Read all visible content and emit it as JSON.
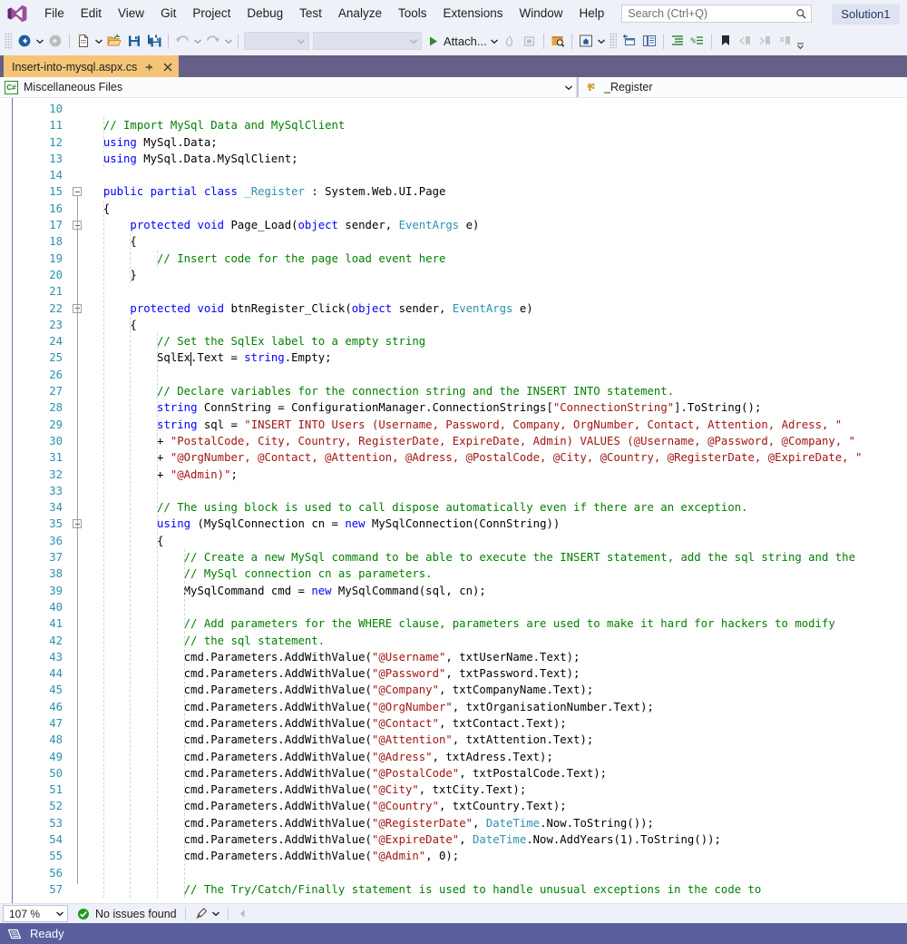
{
  "app": {
    "solution_chip": "Solution1"
  },
  "menubar": {
    "logo_icon": "visual-studio-logo",
    "items": [
      {
        "label": "File"
      },
      {
        "label": "Edit"
      },
      {
        "label": "View"
      },
      {
        "label": "Git"
      },
      {
        "label": "Project"
      },
      {
        "label": "Debug"
      },
      {
        "label": "Test"
      },
      {
        "label": "Analyze"
      },
      {
        "label": "Tools"
      },
      {
        "label": "Extensions"
      },
      {
        "label": "Window"
      },
      {
        "label": "Help"
      }
    ],
    "search": {
      "placeholder": "Search (Ctrl+Q)",
      "value": "",
      "icon": "search-icon"
    }
  },
  "toolbar": {
    "back_icon": "navigate-backward-icon",
    "forward_icon": "navigate-forward-icon",
    "new_item_icon": "new-item-icon",
    "open_file_icon": "open-file-icon",
    "save_icon": "save-icon",
    "save_all_icon": "save-all-icon",
    "undo_icon": "undo-icon",
    "redo_icon": "redo-icon",
    "combo1_value": "",
    "combo2_value": "",
    "attach_label": "Attach...",
    "attach_play_icon": "start-debug-icon",
    "hot_reload_icon": "hot-reload-icon",
    "stop_icon": "stop-icon",
    "find_in_files_icon": "find-in-files-icon",
    "solution_explorer_icon": "home-icon",
    "properties_window_icon": "properties-window-icon",
    "toolbox_icon": "toolbox-icon",
    "indent_icon": "indent-icon",
    "comment_icon": "comment-icon",
    "bookmark_icon": "bookmark-icon",
    "prev_bookmark_icon": "previous-bookmark-icon",
    "next_bookmark_icon": "next-bookmark-icon",
    "clear_bookmark_icon": "clear-bookmarks-icon",
    "overflow_icon": "toolbar-overflow-icon"
  },
  "tabs": [
    {
      "title": "Insert-into-mysql.aspx.cs",
      "pin_icon": "pin-icon",
      "close_icon": "close-icon",
      "active": true
    }
  ],
  "navbar": {
    "project_icon": "csharp-file-icon",
    "project_label": "Miscellaneous Files",
    "dropdown_icon": "chevron-down-icon",
    "member_icon": "class-icon",
    "member_label": "_Register"
  },
  "editor": {
    "first_line": 10,
    "lines": [
      {
        "n": 10,
        "tokens": [],
        "fold": null
      },
      {
        "n": 11,
        "tokens": [
          {
            "t": "  // Import MySql Data and MySqlClient",
            "c": "cm"
          }
        ]
      },
      {
        "n": 12,
        "tokens": [
          {
            "t": "  ",
            "c": "pl"
          },
          {
            "t": "using",
            "c": "kw"
          },
          {
            "t": " MySql.Data;",
            "c": "pl"
          }
        ]
      },
      {
        "n": 13,
        "tokens": [
          {
            "t": "  ",
            "c": "pl"
          },
          {
            "t": "using",
            "c": "kw"
          },
          {
            "t": " MySql.Data.MySqlClient;",
            "c": "pl"
          }
        ]
      },
      {
        "n": 14,
        "tokens": []
      },
      {
        "n": 15,
        "fold": "open",
        "tokens": [
          {
            "t": "  ",
            "c": "pl"
          },
          {
            "t": "public partial class",
            "c": "kw"
          },
          {
            "t": " ",
            "c": "pl"
          },
          {
            "t": "_Register",
            "c": "type"
          },
          {
            "t": " : System.Web.UI.Page",
            "c": "pl"
          }
        ]
      },
      {
        "n": 16,
        "tokens": [
          {
            "t": "  {",
            "c": "pl"
          }
        ]
      },
      {
        "n": 17,
        "fold": "open",
        "tokens": [
          {
            "t": "      ",
            "c": "pl"
          },
          {
            "t": "protected void",
            "c": "kw"
          },
          {
            "t": " Page_Load(",
            "c": "pl"
          },
          {
            "t": "object",
            "c": "kw"
          },
          {
            "t": " sender, ",
            "c": "pl"
          },
          {
            "t": "EventArgs",
            "c": "type"
          },
          {
            "t": " e)",
            "c": "pl"
          }
        ]
      },
      {
        "n": 18,
        "tokens": [
          {
            "t": "      {",
            "c": "pl"
          }
        ]
      },
      {
        "n": 19,
        "tokens": [
          {
            "t": "          // Insert code for the page load event here",
            "c": "cm"
          }
        ]
      },
      {
        "n": 20,
        "tokens": [
          {
            "t": "      }",
            "c": "pl"
          }
        ]
      },
      {
        "n": 21,
        "tokens": []
      },
      {
        "n": 22,
        "fold": "open",
        "tokens": [
          {
            "t": "      ",
            "c": "pl"
          },
          {
            "t": "protected void",
            "c": "kw"
          },
          {
            "t": " btnRegister_Click(",
            "c": "pl"
          },
          {
            "t": "object",
            "c": "kw"
          },
          {
            "t": " sender, ",
            "c": "pl"
          },
          {
            "t": "EventArgs",
            "c": "type"
          },
          {
            "t": " e)",
            "c": "pl"
          }
        ]
      },
      {
        "n": 23,
        "tokens": [
          {
            "t": "      {",
            "c": "pl"
          }
        ]
      },
      {
        "n": 24,
        "tokens": [
          {
            "t": "          // Set the SqlEx label to a empty string",
            "c": "cm"
          }
        ]
      },
      {
        "n": 25,
        "caret_after": "          SqlEx",
        "tokens": [
          {
            "t": "          SqlEx.Text = ",
            "c": "pl"
          },
          {
            "t": "string",
            "c": "kw"
          },
          {
            "t": ".Empty;",
            "c": "pl"
          }
        ]
      },
      {
        "n": 26,
        "tokens": []
      },
      {
        "n": 27,
        "tokens": [
          {
            "t": "          // Declare variables for the connection string and the INSERT INTO statement.",
            "c": "cm"
          }
        ]
      },
      {
        "n": 28,
        "tokens": [
          {
            "t": "          ",
            "c": "pl"
          },
          {
            "t": "string",
            "c": "kw"
          },
          {
            "t": " ConnString = ConfigurationManager.ConnectionStrings[",
            "c": "pl"
          },
          {
            "t": "\"ConnectionString\"",
            "c": "str"
          },
          {
            "t": "].ToString();",
            "c": "pl"
          }
        ]
      },
      {
        "n": 29,
        "tokens": [
          {
            "t": "          ",
            "c": "pl"
          },
          {
            "t": "string",
            "c": "kw"
          },
          {
            "t": " sql = ",
            "c": "pl"
          },
          {
            "t": "\"INSERT INTO Users (Username, Password, Company, OrgNumber, Contact, Attention, Adress, \"",
            "c": "str"
          }
        ]
      },
      {
        "n": 30,
        "tokens": [
          {
            "t": "          + ",
            "c": "pl"
          },
          {
            "t": "\"PostalCode, City, Country, RegisterDate, ExpireDate, Admin) VALUES (@Username, @Password, @Company, \"",
            "c": "str"
          }
        ]
      },
      {
        "n": 31,
        "tokens": [
          {
            "t": "          + ",
            "c": "pl"
          },
          {
            "t": "\"@OrgNumber, @Contact, @Attention, @Adress, @PostalCode, @City, @Country, @RegisterDate, @ExpireDate, \"",
            "c": "str"
          }
        ]
      },
      {
        "n": 32,
        "tokens": [
          {
            "t": "          + ",
            "c": "pl"
          },
          {
            "t": "\"@Admin)\"",
            "c": "str"
          },
          {
            "t": ";",
            "c": "pl"
          }
        ]
      },
      {
        "n": 33,
        "tokens": []
      },
      {
        "n": 34,
        "tokens": [
          {
            "t": "          // The using block is used to call dispose automatically even if there are an exception.",
            "c": "cm"
          }
        ]
      },
      {
        "n": 35,
        "fold": "open",
        "tokens": [
          {
            "t": "          ",
            "c": "pl"
          },
          {
            "t": "using",
            "c": "kw"
          },
          {
            "t": " (MySqlConnection cn = ",
            "c": "pl"
          },
          {
            "t": "new",
            "c": "kw"
          },
          {
            "t": " MySqlConnection(ConnString))",
            "c": "pl"
          }
        ]
      },
      {
        "n": 36,
        "tokens": [
          {
            "t": "          {",
            "c": "pl"
          }
        ]
      },
      {
        "n": 37,
        "tokens": [
          {
            "t": "              // Create a new MySql command to be able to execute the INSERT statement, add the sql string and the",
            "c": "cm"
          }
        ]
      },
      {
        "n": 38,
        "tokens": [
          {
            "t": "              // MySql connection cn as parameters.",
            "c": "cm"
          }
        ]
      },
      {
        "n": 39,
        "tokens": [
          {
            "t": "              MySqlCommand cmd = ",
            "c": "pl"
          },
          {
            "t": "new",
            "c": "kw"
          },
          {
            "t": " MySqlCommand(sql, cn);",
            "c": "pl"
          }
        ]
      },
      {
        "n": 40,
        "tokens": []
      },
      {
        "n": 41,
        "tokens": [
          {
            "t": "              // Add parameters for the WHERE clause, parameters are used to make it hard for hackers to modify",
            "c": "cm"
          }
        ]
      },
      {
        "n": 42,
        "tokens": [
          {
            "t": "              // the sql statement.",
            "c": "cm"
          }
        ]
      },
      {
        "n": 43,
        "tokens": [
          {
            "t": "              cmd.Parameters.AddWithValue(",
            "c": "pl"
          },
          {
            "t": "\"@Username\"",
            "c": "str"
          },
          {
            "t": ", txtUserName.Text);",
            "c": "pl"
          }
        ]
      },
      {
        "n": 44,
        "tokens": [
          {
            "t": "              cmd.Parameters.AddWithValue(",
            "c": "pl"
          },
          {
            "t": "\"@Password\"",
            "c": "str"
          },
          {
            "t": ", txtPassword.Text);",
            "c": "pl"
          }
        ]
      },
      {
        "n": 45,
        "tokens": [
          {
            "t": "              cmd.Parameters.AddWithValue(",
            "c": "pl"
          },
          {
            "t": "\"@Company\"",
            "c": "str"
          },
          {
            "t": ", txtCompanyName.Text);",
            "c": "pl"
          }
        ]
      },
      {
        "n": 46,
        "tokens": [
          {
            "t": "              cmd.Parameters.AddWithValue(",
            "c": "pl"
          },
          {
            "t": "\"@OrgNumber\"",
            "c": "str"
          },
          {
            "t": ", txtOrganisationNumber.Text);",
            "c": "pl"
          }
        ]
      },
      {
        "n": 47,
        "tokens": [
          {
            "t": "              cmd.Parameters.AddWithValue(",
            "c": "pl"
          },
          {
            "t": "\"@Contact\"",
            "c": "str"
          },
          {
            "t": ", txtContact.Text);",
            "c": "pl"
          }
        ]
      },
      {
        "n": 48,
        "tokens": [
          {
            "t": "              cmd.Parameters.AddWithValue(",
            "c": "pl"
          },
          {
            "t": "\"@Attention\"",
            "c": "str"
          },
          {
            "t": ", txtAttention.Text);",
            "c": "pl"
          }
        ]
      },
      {
        "n": 49,
        "tokens": [
          {
            "t": "              cmd.Parameters.AddWithValue(",
            "c": "pl"
          },
          {
            "t": "\"@Adress\"",
            "c": "str"
          },
          {
            "t": ", txtAdress.Text);",
            "c": "pl"
          }
        ]
      },
      {
        "n": 50,
        "tokens": [
          {
            "t": "              cmd.Parameters.AddWithValue(",
            "c": "pl"
          },
          {
            "t": "\"@PostalCode\"",
            "c": "str"
          },
          {
            "t": ", txtPostalCode.Text);",
            "c": "pl"
          }
        ]
      },
      {
        "n": 51,
        "tokens": [
          {
            "t": "              cmd.Parameters.AddWithValue(",
            "c": "pl"
          },
          {
            "t": "\"@City\"",
            "c": "str"
          },
          {
            "t": ", txtCity.Text);",
            "c": "pl"
          }
        ]
      },
      {
        "n": 52,
        "tokens": [
          {
            "t": "              cmd.Parameters.AddWithValue(",
            "c": "pl"
          },
          {
            "t": "\"@Country\"",
            "c": "str"
          },
          {
            "t": ", txtCountry.Text);",
            "c": "pl"
          }
        ]
      },
      {
        "n": 53,
        "tokens": [
          {
            "t": "              cmd.Parameters.AddWithValue(",
            "c": "pl"
          },
          {
            "t": "\"@RegisterDate\"",
            "c": "str"
          },
          {
            "t": ", ",
            "c": "pl"
          },
          {
            "t": "DateTime",
            "c": "type"
          },
          {
            "t": ".Now.ToString());",
            "c": "pl"
          }
        ]
      },
      {
        "n": 54,
        "tokens": [
          {
            "t": "              cmd.Parameters.AddWithValue(",
            "c": "pl"
          },
          {
            "t": "\"@ExpireDate\"",
            "c": "str"
          },
          {
            "t": ", ",
            "c": "pl"
          },
          {
            "t": "DateTime",
            "c": "type"
          },
          {
            "t": ".Now.AddYears(1).ToString());",
            "c": "pl"
          }
        ]
      },
      {
        "n": 55,
        "tokens": [
          {
            "t": "              cmd.Parameters.AddWithValue(",
            "c": "pl"
          },
          {
            "t": "\"@Admin\"",
            "c": "str"
          },
          {
            "t": ", 0);",
            "c": "pl"
          }
        ]
      },
      {
        "n": 56,
        "tokens": []
      },
      {
        "n": 57,
        "tokens": [
          {
            "t": "              // The Try/Catch/Finally statement is used to handle unusual exceptions in the code to",
            "c": "cm"
          }
        ]
      }
    ],
    "syntax_colors": {
      "keyword": "#0000ff",
      "comment": "#008000",
      "string": "#a31515",
      "type": "#2b91af",
      "plain": "#000000",
      "line_number": "#2b91af"
    }
  },
  "editor_status": {
    "zoom_value": "107 %",
    "zoom_caret_icon": "chevron-down-icon",
    "issues_icon": "check-circle-icon",
    "issues_text": "No issues found",
    "brush_icon": "code-cleanup-icon",
    "brush_caret_icon": "chevron-down-icon",
    "prev_icon": "scroll-left-icon"
  },
  "statusbar": {
    "icon": "status-ready-icon",
    "text": "Ready",
    "background": "#5b5f9e"
  }
}
